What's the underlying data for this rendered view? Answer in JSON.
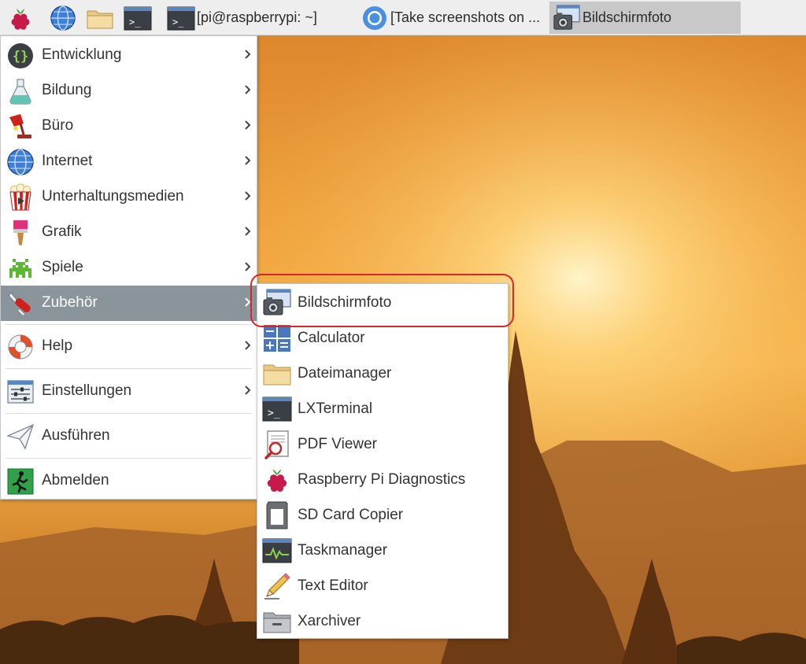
{
  "taskbar": {
    "menu_button_icon": "raspberry-icon",
    "launchers": [
      "globe-icon",
      "folder-icon",
      "terminal-icon"
    ],
    "windows": [
      {
        "label": "[pi@raspberrypi: ~]",
        "icon": "terminal-icon"
      },
      {
        "label": "[Take screenshots on ...",
        "icon": "chromium-icon"
      },
      {
        "label": "Bildschirmfoto",
        "icon": "camera-screenshot-icon",
        "active": true
      }
    ]
  },
  "main_menu": {
    "items": [
      {
        "label": "Entwicklung",
        "icon": "braces-icon",
        "submenu": true
      },
      {
        "label": "Bildung",
        "icon": "flask-icon",
        "submenu": true
      },
      {
        "label": "Büro",
        "icon": "desk-lamp-icon",
        "submenu": true
      },
      {
        "label": "Internet",
        "icon": "globe-icon",
        "submenu": true
      },
      {
        "label": "Unterhaltungsmedien",
        "icon": "popcorn-icon",
        "submenu": true
      },
      {
        "label": "Grafik",
        "icon": "paintbrush-icon",
        "submenu": true
      },
      {
        "label": "Spiele",
        "icon": "space-invader-icon",
        "submenu": true
      },
      {
        "label": "Zubehör",
        "icon": "swiss-knife-icon",
        "submenu": true,
        "highlighted": true
      },
      {
        "label": "Help",
        "icon": "lifebuoy-icon",
        "submenu": true
      },
      {
        "label": "Einstellungen",
        "icon": "settings-sliders-icon",
        "submenu": true
      },
      {
        "label": "Ausführen",
        "icon": "paper-plane-icon",
        "submenu": false
      },
      {
        "label": "Abmelden",
        "icon": "exit-icon",
        "submenu": false
      }
    ]
  },
  "accessories_menu": {
    "items": [
      {
        "label": "Bildschirmfoto",
        "icon": "camera-screenshot-icon",
        "circled": true
      },
      {
        "label": "Calculator",
        "icon": "calculator-icon"
      },
      {
        "label": "Dateimanager",
        "icon": "folder-icon"
      },
      {
        "label": "LXTerminal",
        "icon": "terminal-icon"
      },
      {
        "label": "PDF Viewer",
        "icon": "pdf-viewer-icon"
      },
      {
        "label": "Raspberry Pi Diagnostics",
        "icon": "raspberry-icon"
      },
      {
        "label": "SD Card Copier",
        "icon": "sd-card-icon"
      },
      {
        "label": "Taskmanager",
        "icon": "task-monitor-icon"
      },
      {
        "label": "Text Editor",
        "icon": "pencil-icon"
      },
      {
        "label": "Xarchiver",
        "icon": "archive-icon"
      }
    ]
  },
  "annotation": {
    "color": "#d8262b"
  },
  "colors": {
    "highlight": "#8a949b",
    "taskbar": "#eeeeee",
    "menu_bg": "#ffffff"
  }
}
